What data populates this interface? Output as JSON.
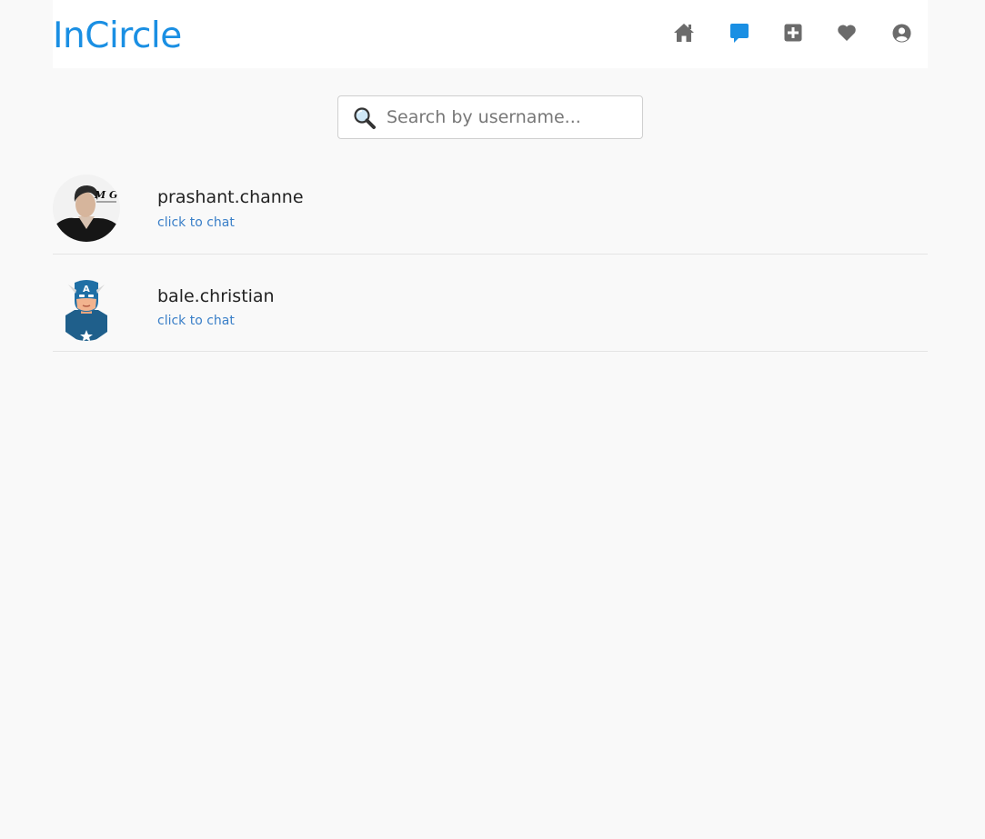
{
  "app": {
    "brand": "InCircle",
    "brand_color": "#1a8fe3",
    "active_color": "#1a8fe3",
    "icon_color": "#6b6b6b"
  },
  "nav": {
    "items": [
      {
        "icon": "home-icon",
        "active": false
      },
      {
        "icon": "chat-bubble-icon",
        "active": true
      },
      {
        "icon": "plus-square-icon",
        "active": false
      },
      {
        "icon": "heart-icon",
        "active": false
      },
      {
        "icon": "user-circle-icon",
        "active": false
      }
    ]
  },
  "search": {
    "icon": "magnifier-icon",
    "placeholder": "Search by username...",
    "value": ""
  },
  "chats": [
    {
      "username": "prashant.channe",
      "subtitle": "click to chat",
      "avatar": "photo-avatar"
    },
    {
      "username": "bale.christian",
      "subtitle": "click to chat",
      "avatar": "captain-america-avatar"
    }
  ]
}
